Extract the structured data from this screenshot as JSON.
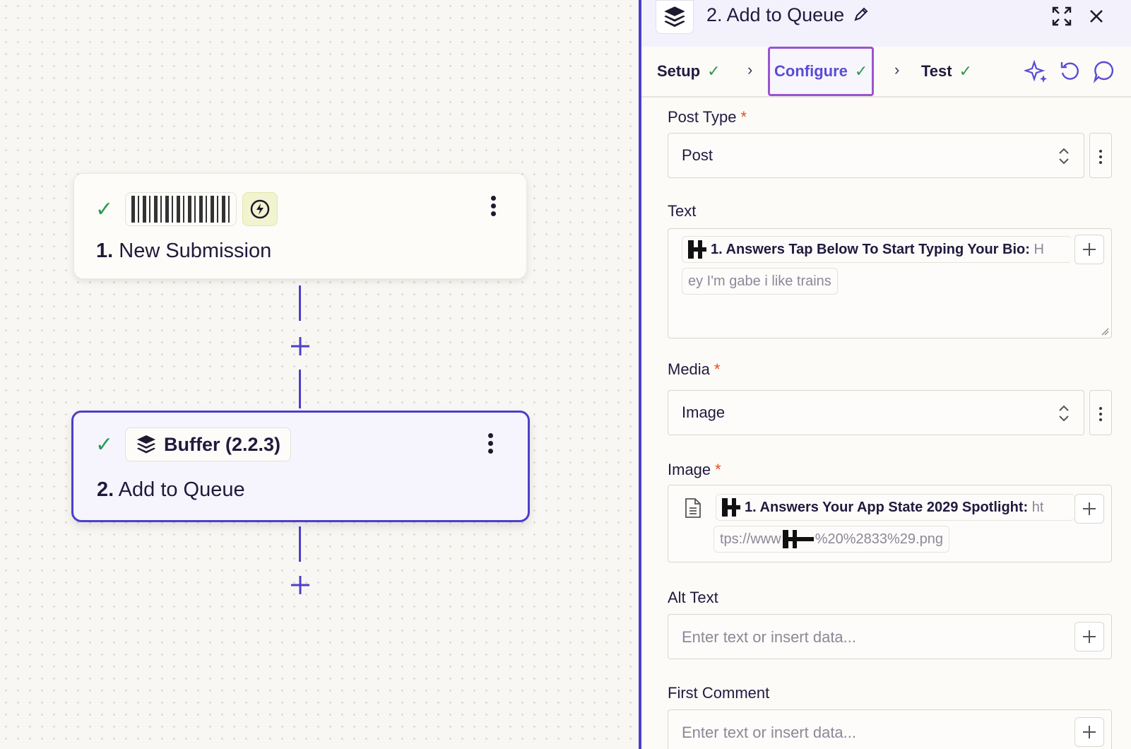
{
  "canvas": {
    "step1": {
      "number": "1.",
      "title": "New Submission"
    },
    "step2": {
      "number": "2.",
      "title": "Add to Queue",
      "app_label": "Buffer (2.2.3)"
    }
  },
  "panel": {
    "title": "2. Add to Queue",
    "tabs": [
      {
        "label": "Setup",
        "status": "complete"
      },
      {
        "label": "Configure",
        "status": "complete",
        "active": true
      },
      {
        "label": "Test",
        "status": "complete"
      }
    ],
    "fields": {
      "post_type": {
        "label": "Post Type",
        "required": true,
        "value": "Post"
      },
      "text": {
        "label": "Text",
        "pill_bold": "1. Answers Tap Below To Start Typing Your Bio:",
        "pill_tail": "H",
        "pill_cont": "ey I'm gabe i like trains"
      },
      "media": {
        "label": "Media",
        "required": true,
        "value": "Image"
      },
      "image": {
        "label": "Image",
        "required": true,
        "pill_bold": "1. Answers Your App State 2029 Spotlight:",
        "pill_tail": "ht",
        "pill_cont_a": "tps://www",
        "pill_cont_b": "%20%2833%29.png"
      },
      "alt_text": {
        "label": "Alt Text",
        "placeholder": "Enter text or insert data..."
      },
      "first_comment": {
        "label": "First Comment",
        "placeholder": "Enter text or insert data..."
      }
    }
  },
  "colors": {
    "accent": "#4c3fc9",
    "success": "#2c9b4f",
    "required": "#e0511b",
    "configure_border": "#9b54d1"
  }
}
